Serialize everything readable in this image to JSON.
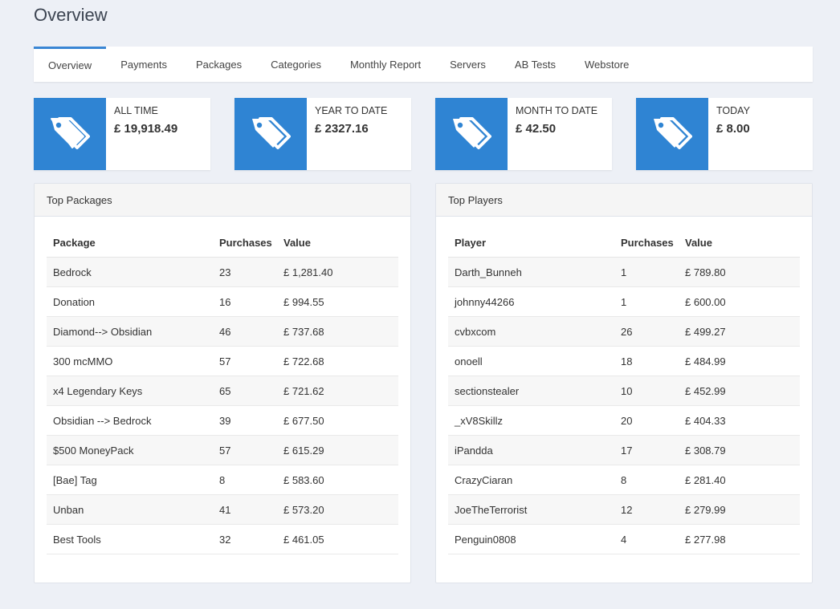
{
  "page": {
    "title": "Overview"
  },
  "tabs": [
    {
      "label": "Overview",
      "active": true
    },
    {
      "label": "Payments"
    },
    {
      "label": "Packages"
    },
    {
      "label": "Categories"
    },
    {
      "label": "Monthly Report"
    },
    {
      "label": "Servers"
    },
    {
      "label": "AB Tests"
    },
    {
      "label": "Webstore"
    }
  ],
  "stats": [
    {
      "label": "ALL TIME",
      "value": "£ 19,918.49",
      "icon": "tags-icon"
    },
    {
      "label": "YEAR TO DATE",
      "value": "£ 2327.16",
      "icon": "tags-icon"
    },
    {
      "label": "MONTH TO DATE",
      "value": "£ 42.50",
      "icon": "tags-icon"
    },
    {
      "label": "TODAY",
      "value": "£ 8.00",
      "icon": "tags-icon"
    }
  ],
  "top_packages": {
    "title": "Top Packages",
    "headers": [
      "Package",
      "Purchases",
      "Value"
    ],
    "rows": [
      [
        "Bedrock",
        "23",
        "£ 1,281.40"
      ],
      [
        "Donation",
        "16",
        "£ 994.55"
      ],
      [
        "Diamond--> Obsidian",
        "46",
        "£ 737.68"
      ],
      [
        "300 mcMMO",
        "57",
        "£ 722.68"
      ],
      [
        "x4 Legendary Keys",
        "65",
        "£ 721.62"
      ],
      [
        "Obsidian --> Bedrock",
        "39",
        "£ 677.50"
      ],
      [
        "$500 MoneyPack",
        "57",
        "£ 615.29"
      ],
      [
        "[Bae] Tag",
        "8",
        "£ 583.60"
      ],
      [
        "Unban",
        "41",
        "£ 573.20"
      ],
      [
        "Best Tools",
        "32",
        "£ 461.05"
      ]
    ]
  },
  "top_players": {
    "title": "Top Players",
    "headers": [
      "Player",
      "Purchases",
      "Value"
    ],
    "rows": [
      [
        "Darth_Bunneh",
        "1",
        "£ 789.80"
      ],
      [
        "johnny44266",
        "1",
        "£ 600.00"
      ],
      [
        "cvbxcom",
        "26",
        "£ 499.27"
      ],
      [
        "onoell",
        "18",
        "£ 484.99"
      ],
      [
        "sectionstealer",
        "10",
        "£ 452.99"
      ],
      [
        "_xV8Skillz",
        "20",
        "£ 404.33"
      ],
      [
        "iPandda",
        "17",
        "£ 308.79"
      ],
      [
        "CrazyCiaran",
        "8",
        "£ 281.40"
      ],
      [
        "JoeTheTerrorist",
        "12",
        "£ 279.99"
      ],
      [
        "Penguin0808",
        "4",
        "£ 277.98"
      ]
    ]
  },
  "colors": {
    "accent": "#2f84d3",
    "background": "#edf0f6"
  }
}
